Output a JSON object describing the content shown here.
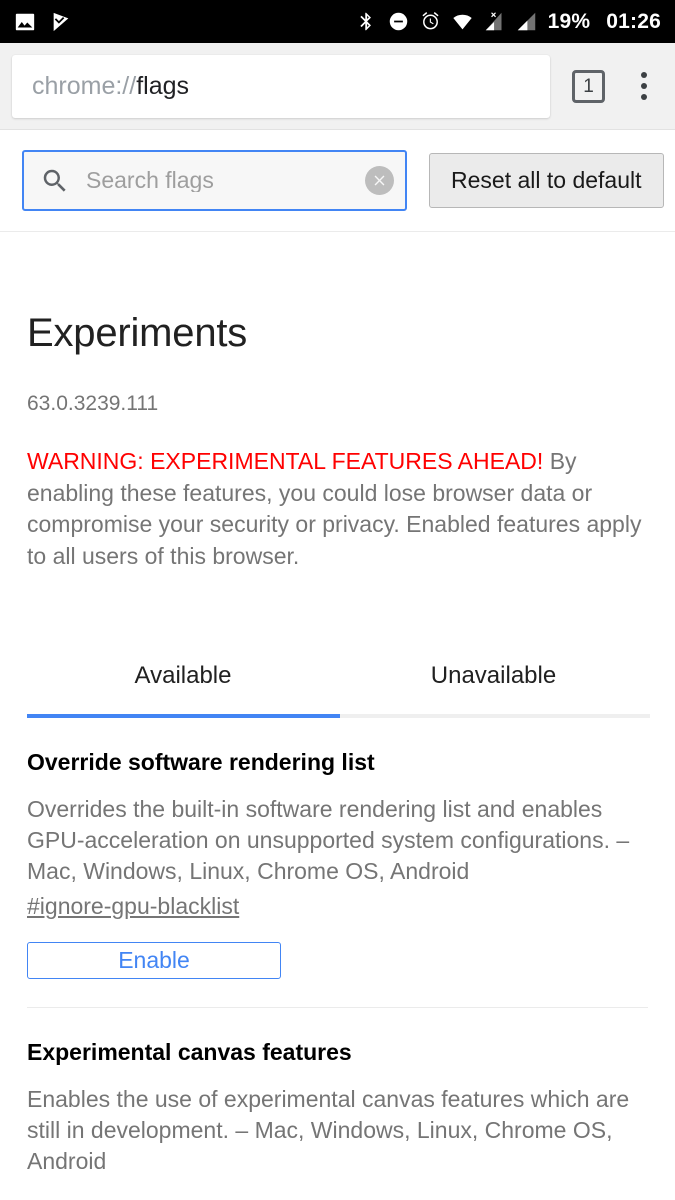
{
  "statusbar": {
    "left_icons": [
      {
        "name": "photo-icon"
      },
      {
        "name": "checkmark-flag-icon"
      }
    ],
    "right_icons": [
      {
        "name": "bluetooth-icon"
      },
      {
        "name": "do-not-disturb-icon"
      },
      {
        "name": "alarm-icon"
      },
      {
        "name": "wifi-icon"
      },
      {
        "name": "no-sim-signal-icon"
      },
      {
        "name": "cell-signal-icon"
      }
    ],
    "battery": "19%",
    "time": "01:26"
  },
  "toolbar": {
    "url_scheme": "chrome://",
    "url_host": "flags",
    "tab_count": "1",
    "tab_switcher_name": "tab-switcher-button",
    "menu_name": "overflow-menu-button"
  },
  "search": {
    "placeholder": "Search flags",
    "value": "",
    "clear_label": "✕",
    "reset_label": "Reset all to default"
  },
  "page": {
    "title": "Experiments",
    "version": "63.0.3239.111",
    "warning_strong": "WARNING: EXPERIMENTAL FEATURES AHEAD!",
    "warning_body": " By enabling these features, you could lose browser data or compromise your security or privacy. Enabled features apply to all users of this browser."
  },
  "tabs": [
    {
      "label": "Available",
      "active": true
    },
    {
      "label": "Unavailable",
      "active": false
    }
  ],
  "flags": [
    {
      "title": "Override software rendering list",
      "description": "Overrides the built-in software rendering list and enables GPU-acceleration on unsupported system configurations.  – Mac, Windows, Linux, Chrome OS, Android",
      "anchor": "#ignore-gpu-blacklist",
      "button": "Enable"
    },
    {
      "title": "Experimental canvas features",
      "description": "Enables the use of experimental canvas features which are still in development.  – Mac, Windows, Linux, Chrome OS, Android"
    }
  ],
  "colors": {
    "accent_blue": "#4285f4",
    "warning_red": "#ff0000",
    "status_bar_bg": "#000000",
    "toolbar_bg": "#f1f1f1",
    "muted_text": "#757575"
  }
}
